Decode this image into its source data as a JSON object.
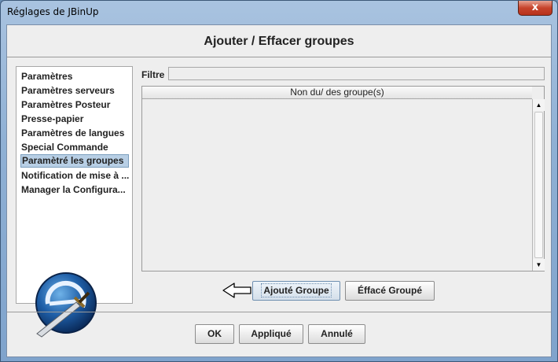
{
  "window": {
    "title": "Réglages de JBinUp",
    "close_label": "x"
  },
  "header": {
    "title": "Ajouter / Effacer groupes"
  },
  "sidebar": {
    "items": [
      {
        "label": "Paramètres",
        "selected": false
      },
      {
        "label": "Paramètres serveurs",
        "selected": false
      },
      {
        "label": "Paramètres Posteur",
        "selected": false
      },
      {
        "label": "Presse-papier",
        "selected": false
      },
      {
        "label": "Paramètres de langues",
        "selected": false
      },
      {
        "label": "Special Commande",
        "selected": false
      },
      {
        "label": "Paramètré les groupes",
        "selected": true
      },
      {
        "label": "Notification de mise à ...",
        "selected": false
      },
      {
        "label": "Manager la  Configura...",
        "selected": false
      }
    ]
  },
  "filter": {
    "label": "Filtre",
    "value": ""
  },
  "table": {
    "column_header": "Non du/ des groupe(s)",
    "rows": []
  },
  "group_actions": {
    "add_label": "Ajouté Groupe",
    "delete_label": "Éffacé Groupé"
  },
  "footer": {
    "ok_label": "OK",
    "apply_label": "Appliqué",
    "cancel_label": "Annulé"
  },
  "colors": {
    "selection": "#b8cfe5",
    "close_button": "#c7442c",
    "titlebar": "#a9c3e0"
  }
}
